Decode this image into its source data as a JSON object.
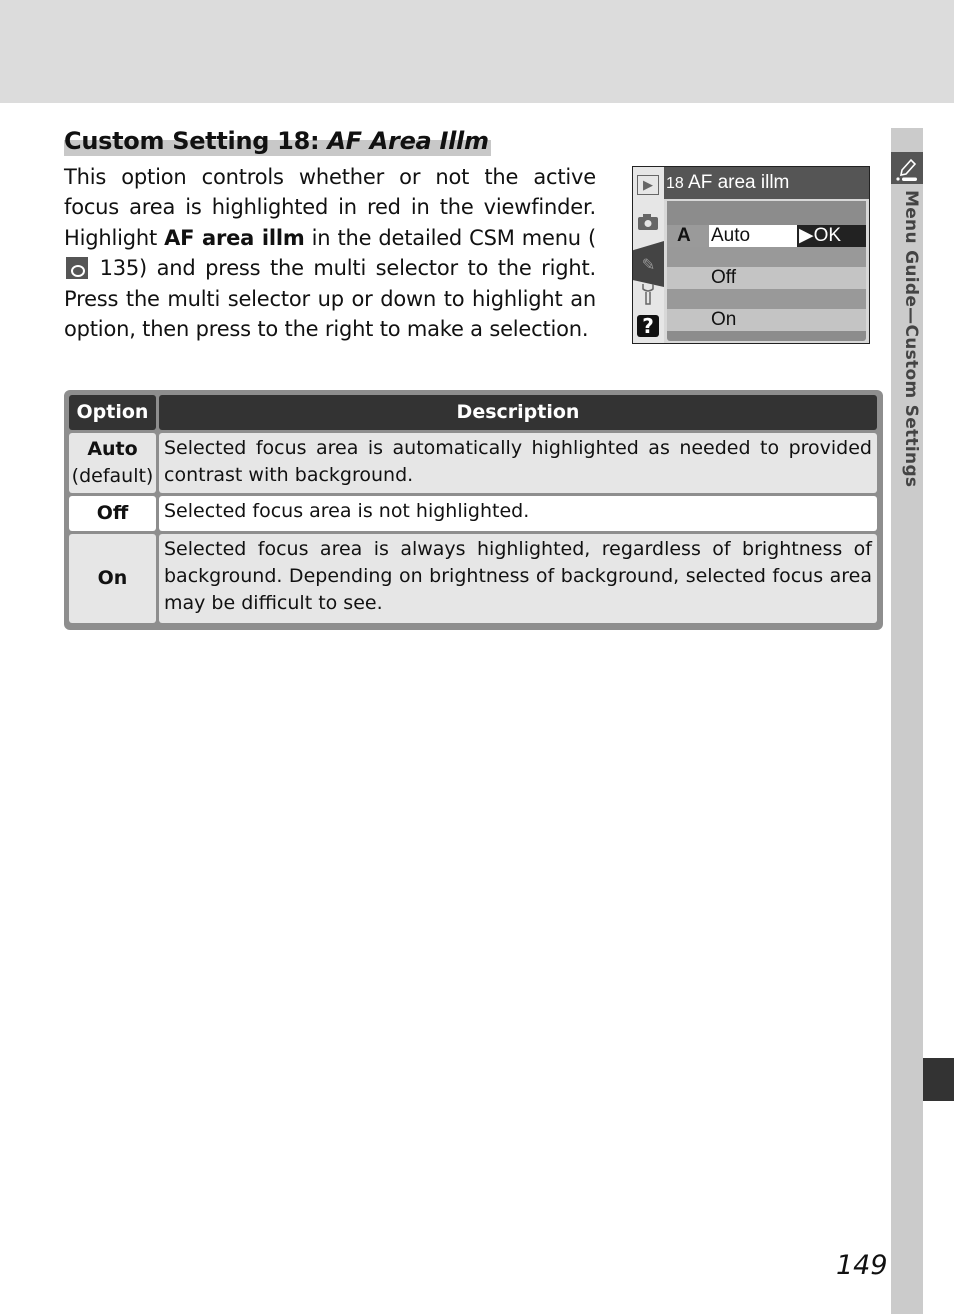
{
  "heading": {
    "prefix": "Custom Setting 18: ",
    "italic": "AF Area Illm"
  },
  "body": {
    "part1": "This option controls whether or not the active focus area is highlighted in red in the viewfinder. Highlight ",
    "bold": "AF area illm",
    "part2": " in the detailed CSM menu (",
    "ref_icon": "menu-reference-icon",
    "part3": " 135) and press the multi selector to the right. Press the multi selector up or down to highlight an option, then press to the right to make a selection."
  },
  "camera_screen": {
    "title_num": "18",
    "title": " AF area illm",
    "left_icons": [
      "play-icon",
      "camera-icon",
      "pencil-icon",
      "wrench-icon",
      "help-icon"
    ],
    "selected_marker": "A",
    "options": [
      "Auto",
      "Off",
      "On"
    ],
    "ok_label": "▶OK"
  },
  "table": {
    "headers": [
      "Option",
      "Description"
    ],
    "rows": [
      {
        "option": "Auto",
        "sub": "(default)",
        "description": "Selected focus area is automatically highlighted as needed to provided contrast with background."
      },
      {
        "option": "Off",
        "sub": "",
        "description": "Selected focus area is not highlighted."
      },
      {
        "option": "On",
        "sub": "",
        "description": "Selected focus area is always highlighted, regardless of brightness of background.  Depending on brightness of background, selected focus area may be difficult to see."
      }
    ]
  },
  "sidebar": {
    "section_label": "Menu Guide—Custom Settings",
    "icon": "custom-settings-pencil-icon"
  },
  "page_number": "149"
}
